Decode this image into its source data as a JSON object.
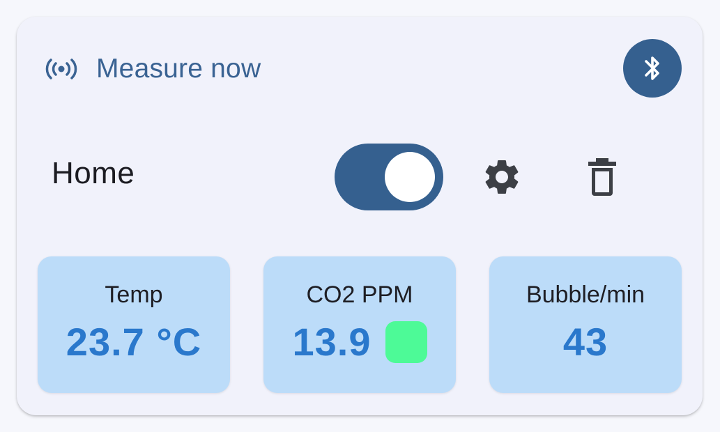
{
  "header": {
    "title": "Measure now",
    "signal_icon": "signal-broadcast-icon",
    "bluetooth_icon": "bluetooth-icon"
  },
  "device": {
    "name": "Home",
    "enabled": true
  },
  "actions": {
    "settings_icon": "gear-icon",
    "delete_icon": "trash-icon"
  },
  "metrics": [
    {
      "label": "Temp",
      "value": "23.7 °C"
    },
    {
      "label": "CO2 PPM",
      "value": "13.9",
      "status_color": "#4dfa97"
    },
    {
      "label": "Bubble/min",
      "value": "43"
    }
  ],
  "colors": {
    "accent": "#35608f",
    "title": "#3a6393",
    "tile_bg": "#bcdcf9",
    "value": "#2a78cc",
    "status_ok": "#4dfa97"
  }
}
